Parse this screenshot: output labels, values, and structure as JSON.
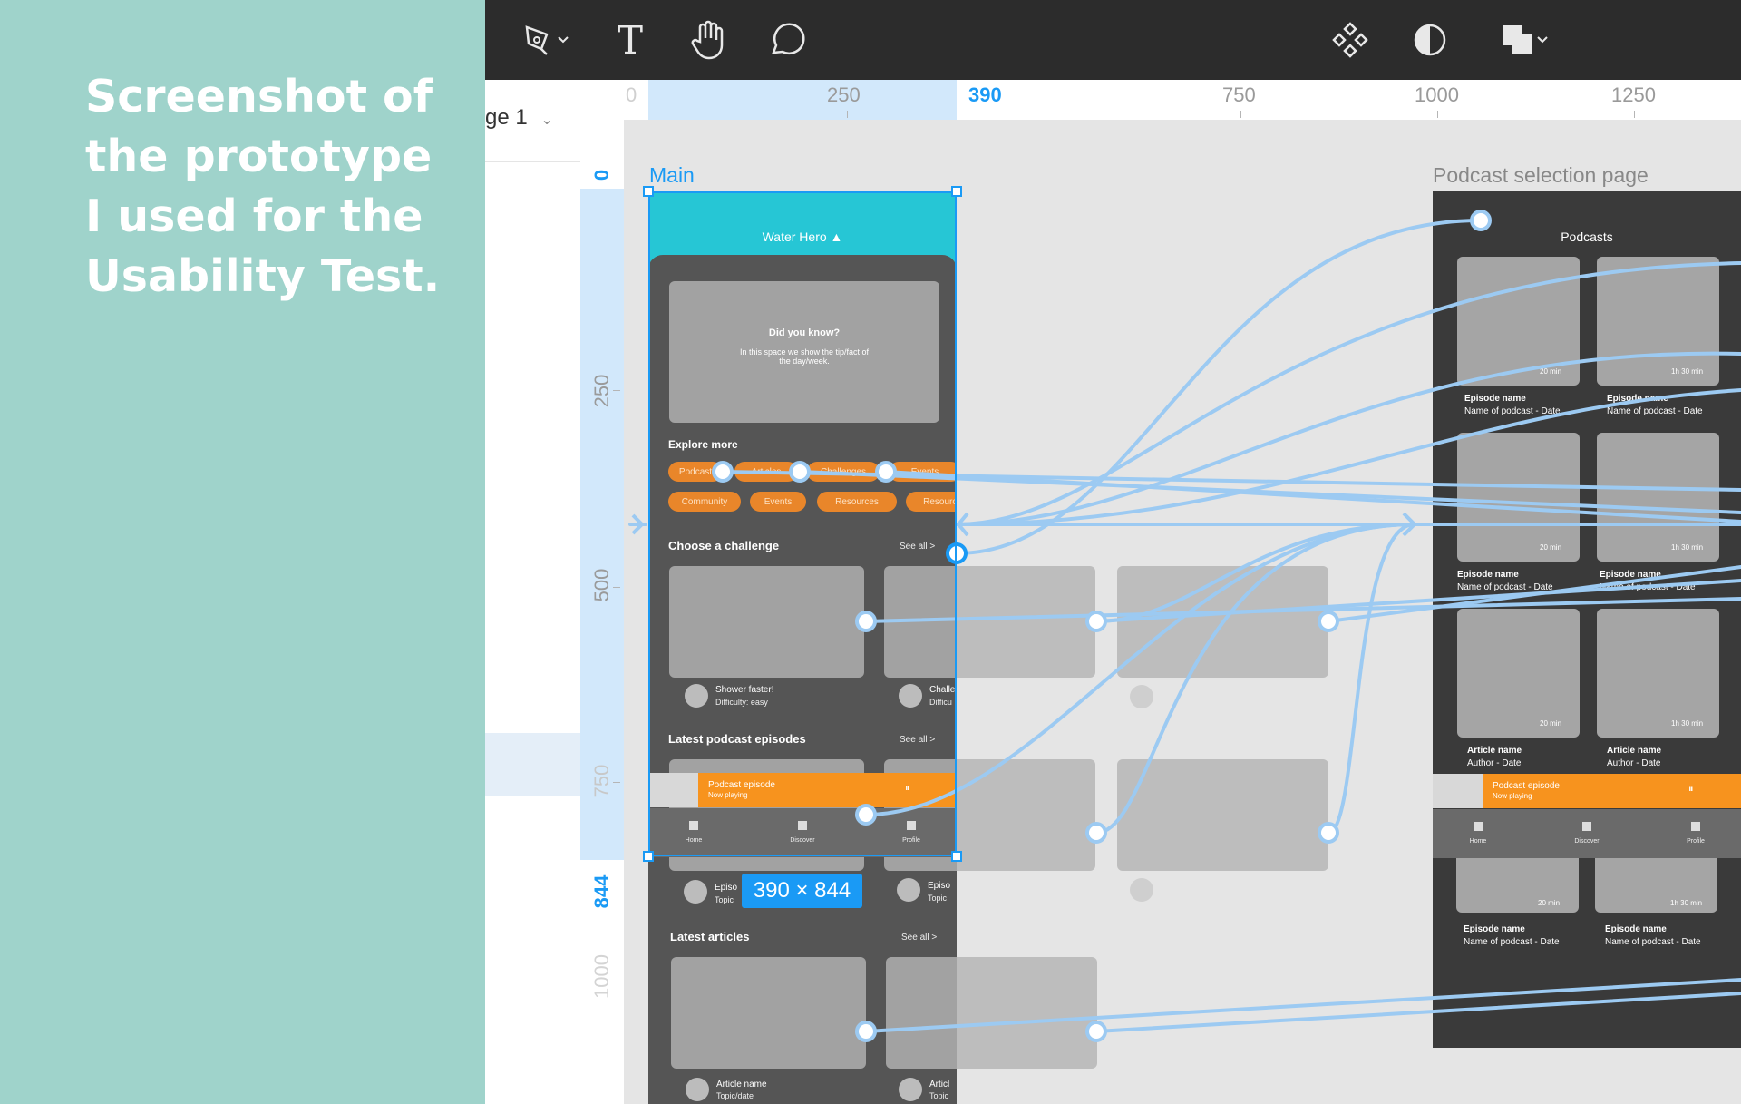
{
  "caption": "Screenshot of\nthe prototype\nI used for the\nUsability Test.",
  "toolbar": {
    "tools": [
      "pen-tool-icon",
      "text-tool-icon",
      "hand-tool-icon",
      "comment-tool-icon"
    ],
    "right_tools": [
      "component-icon",
      "contrast-icon",
      "boolean-ops-icon"
    ],
    "pen_glyph": "✒",
    "text_glyph": "T",
    "hand_glyph": "✋",
    "comment_glyph": "💬"
  },
  "ruler": {
    "top_labels": [
      "0",
      "250",
      "390",
      "750",
      "1000",
      "1250"
    ],
    "left_labels": [
      "0",
      "250",
      "500",
      "750",
      "844",
      "1000"
    ]
  },
  "layers": {
    "page_selector": "ge 1"
  },
  "frames": {
    "main": {
      "title": "Main",
      "header_title": "Water Hero ▲",
      "did_you_know_title": "Did you know?",
      "did_you_know_body": "In this space we show the tip/fact of the day/week.",
      "explore_more": "Explore more",
      "pills_row1": [
        "Podcast",
        "Articles",
        "Challenges",
        "Events"
      ],
      "pills_row2": [
        "Community",
        "Events",
        "Resources",
        "Resources"
      ],
      "choose_challenge": "Choose a challenge",
      "see_all": "See all >",
      "challenge1_title": "Shower faster!",
      "challenge1_sub": "Difficulty: easy",
      "challenge2_title": "Challe",
      "challenge2_sub": "Difficu",
      "latest_podcasts": "Latest podcast episodes",
      "player_title": "Podcast episode",
      "player_sub": "Now playing",
      "pause_glyph": "⏸",
      "nav": [
        "Home",
        "Discover",
        "Profile"
      ],
      "episode1_title": "Episo",
      "episode1_sub": "Topic",
      "episode2_title": "Episo",
      "episode2_sub": "Topic",
      "latest_articles": "Latest articles",
      "article1_title": "Article name",
      "article1_sub": "Topic/date",
      "article2_title": "Articl",
      "article2_sub": "Topic"
    },
    "podcast": {
      "title": "Podcast selection page",
      "header": "Podcasts",
      "cards": [
        {
          "dur": "20 min",
          "title": "Episode name",
          "sub": "Name of podcast - Date"
        },
        {
          "dur": "1h 30 min",
          "title": "Episode name",
          "sub": "Name of podcast - Date"
        },
        {
          "dur": "20 min",
          "title": "Episode name",
          "sub": "Name of podcast - Date"
        },
        {
          "dur": "1h 30 min",
          "title": "Episode name",
          "sub": "Name of podcast - Date"
        },
        {
          "dur": "20 min",
          "title": "Article name",
          "sub": "Author - Date"
        },
        {
          "dur": "1h 30 min",
          "title": "Article name",
          "sub": "Author - Date"
        },
        {
          "dur": "20 min",
          "title": "Episode name",
          "sub": "Name of podcast - Date"
        },
        {
          "dur": "1h 30 min",
          "title": "Episode name",
          "sub": "Name of podcast - Date"
        }
      ],
      "player_title": "Podcast episode",
      "player_sub": "Now playing",
      "pause_glyph": "⏸",
      "nav": [
        "Home",
        "Discover",
        "Profile"
      ]
    }
  },
  "selection": {
    "size_badge": "390 × 844"
  },
  "colors": {
    "accent": "#1a9af5",
    "teal_panel": "#9fd3cb",
    "header_cyan": "#26c6d5",
    "orange": "#f7931e",
    "wire": "#9ccaf2"
  }
}
